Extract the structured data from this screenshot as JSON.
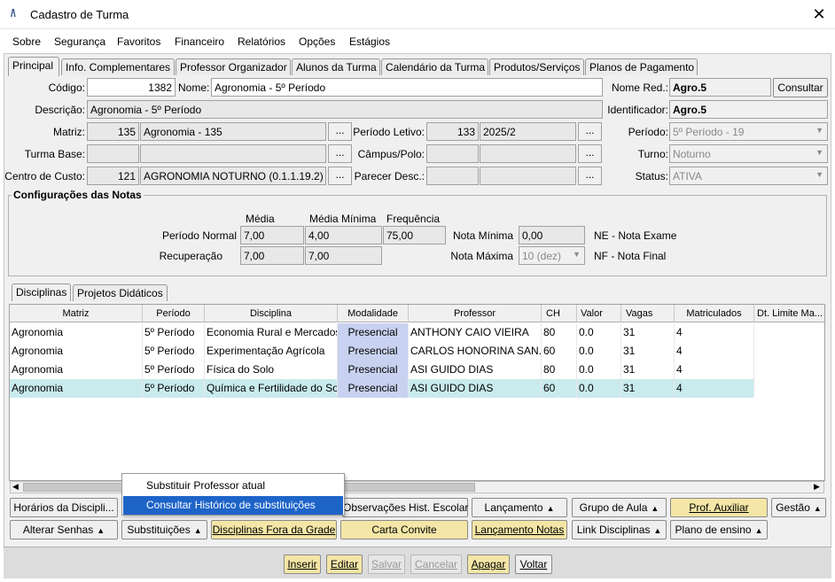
{
  "window": {
    "title": "Cadastro de Turma",
    "logo": "/\\",
    "close": "✕"
  },
  "menu": [
    "Sobre",
    "Segurança",
    "Favoritos",
    "Financeiro",
    "Relatórios",
    "Opções",
    "Estágios"
  ],
  "tabs": [
    "Principal",
    "Info. Complementares",
    "Professor Organizador",
    "Alunos da Turma",
    "Calendário da Turma",
    "Produtos/Serviços",
    "Planos de Pagamento"
  ],
  "form": {
    "codigo_label": "Código:",
    "codigo": "1382",
    "nome_label": "Nome:",
    "nome": "Agronomia - 5º Período",
    "nome_red_label": "Nome Red.:",
    "nome_red": "Agro.5",
    "consultar": "Consultar",
    "descricao_label": "Descrição:",
    "descricao": "Agronomia - 5º Período",
    "identificador_label": "Identificador:",
    "identificador": "Agro.5",
    "matriz_label": "Matriz:",
    "matriz_code": "135",
    "matriz_name": "Agronomia - 135",
    "periodo_letivo_label": "Período Letivo:",
    "periodo_letivo_code": "133",
    "periodo_letivo_name": "2025/2",
    "periodo_label": "Período:",
    "periodo": "5º Período - 19",
    "turma_base_label": "Turma Base:",
    "campus_label": "Câmpus/Polo:",
    "turno_label": "Turno:",
    "turno": "Noturno",
    "centro_custo_label": "Centro de Custo:",
    "centro_custo_code": "121",
    "centro_custo_name": "AGRONOMIA NOTURNO (0.1.1.19.2)",
    "parecer_label": "Parecer Desc.:",
    "status_label": "Status:",
    "status": "ATIVA",
    "dots": "..."
  },
  "notas": {
    "title": "Configurações das Notas",
    "col_media": "Média",
    "col_media_min": "Média Mínima",
    "col_freq": "Frequência",
    "periodo_normal_label": "Período Normal",
    "pn_media": "7,00",
    "pn_media_min": "4,00",
    "pn_freq": "75,00",
    "recuperacao_label": "Recuperação",
    "rec_media": "7,00",
    "rec_media_min": "7,00",
    "nota_minima_label": "Nota Mínima",
    "nota_minima": "0,00",
    "nota_maxima_label": "Nota Máxima",
    "nota_maxima": "10 (dez)",
    "ne_legend": "NE - Nota Exame",
    "nf_legend": "NF - Nota Final"
  },
  "subtabs": [
    "Disciplinas",
    "Projetos Didáticos"
  ],
  "grid": {
    "headers": [
      "Matriz",
      "Período",
      "Disciplina",
      "Modalidade",
      "Professor",
      "CH",
      "Valor",
      "Vagas",
      "Matriculados",
      "Dt. Limite Ma..."
    ],
    "rows": [
      [
        "Agronomia",
        "5º Período",
        "Economia Rural e Mercados",
        "Presencial",
        "ANTHONY CAIO VIEIRA",
        "80",
        "0.0",
        "31",
        "4",
        ""
      ],
      [
        "Agronomia",
        "5º Período",
        "Experimentação Agrícola",
        "Presencial",
        "CARLOS HONORINA SAN...",
        "60",
        "0.0",
        "31",
        "4",
        ""
      ],
      [
        "Agronomia",
        "5º Período",
        "Física do Solo",
        "Presencial",
        "ASI GUIDO DIAS",
        "80",
        "0.0",
        "31",
        "4",
        ""
      ],
      [
        "Agronomia",
        "5º Período",
        "Química e Fertilidade do Sol",
        "Presencial",
        "ASI GUIDO DIAS",
        "60",
        "0.0",
        "31",
        "4",
        ""
      ]
    ]
  },
  "popup": [
    "Substituir Professor atual",
    "Consultar Histórico de substituições"
  ],
  "buttons_row1": [
    "Horários da Discipli...",
    "Observações Hist. Escolar",
    "Lançamento",
    "Grupo de Aula",
    "Prof. Auxiliar",
    "Gestão"
  ],
  "buttons_row2": [
    "Alterar Senhas",
    "Substituições",
    "Disciplinas Fora da Grade",
    "Carta Convite",
    "Lançamento Notas",
    "Link Disciplinas",
    "Plano de ensino"
  ],
  "bottom": [
    "Inserir",
    "Editar",
    "Salvar",
    "Cancelar",
    "Apagar",
    "Voltar"
  ]
}
